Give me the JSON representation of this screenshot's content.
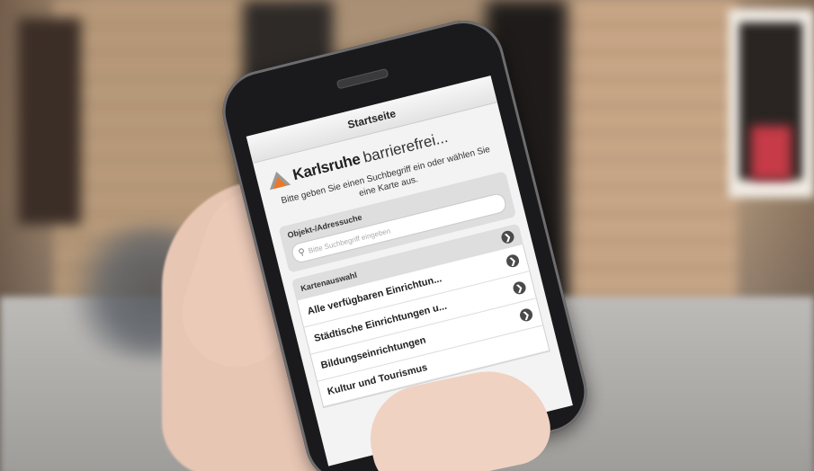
{
  "app": {
    "nav_title": "Startseite",
    "logo_city": "Karlsruhe",
    "logo_suffix": "barrierefrei...",
    "intro_text": "Bitte geben Sie einen Suchbegriff ein oder wählen Sie eine Karte aus."
  },
  "search": {
    "section_title": "Objekt-/Adressuche",
    "placeholder": "Bitte Suchbegriff eingeben"
  },
  "maps": {
    "section_title": "Kartenauswahl",
    "items": [
      {
        "label": "Alle verfügbaren Einrichtun..."
      },
      {
        "label": "Städtische Einrichtungen u..."
      },
      {
        "label": "Bildungseinrichtungen"
      },
      {
        "label": "Kultur und Tourismus"
      }
    ]
  },
  "colors": {
    "logo_orange": "#e8792b",
    "logo_gray": "#9a9a9a"
  }
}
